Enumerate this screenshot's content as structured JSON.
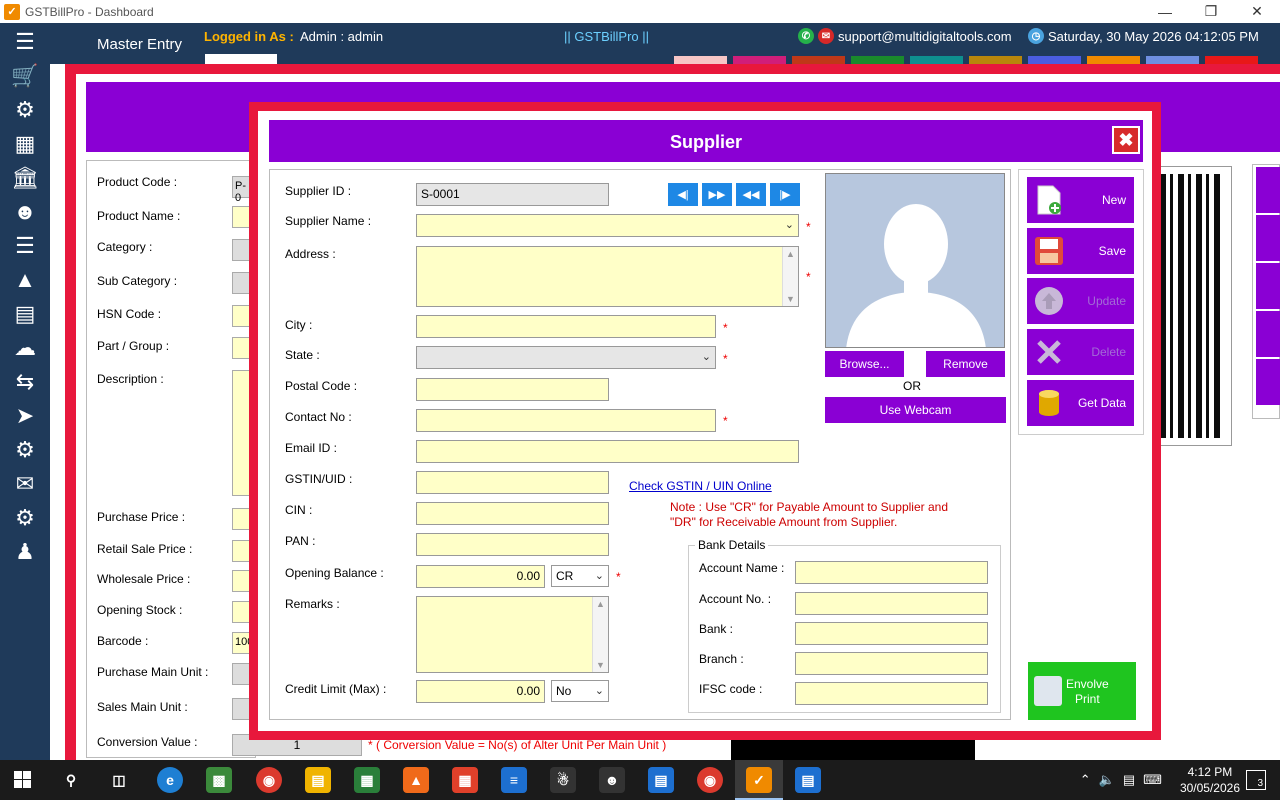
{
  "window": {
    "title": "GSTBillPro - Dashboard"
  },
  "header": {
    "section": "Master Entry",
    "logged_label": "Logged in As :",
    "user": "Admin   :  admin",
    "app_name": "|| GSTBillPro ||",
    "support_email": "support@multidigitaltools.com",
    "datetime": "Saturday, 30 May 2026 04:12:05 PM"
  },
  "colors": {
    "accent": "#8a00d4",
    "frame": "#e8183c",
    "field_bg": "#ffffc8",
    "header_bg": "#1f3a5a",
    "print_green": "#1fc51f"
  },
  "product_form": {
    "labels": [
      "Product Code :",
      "Product Name :",
      "Category :",
      "Sub Category :",
      "HSN Code :",
      "Part / Group :",
      "Description :",
      "Purchase Price :",
      "Retail Sale Price :",
      "Wholesale Price :",
      "Opening Stock :",
      "Barcode :",
      "Purchase Main Unit :",
      "Sales Main Unit :",
      "Conversion Value :"
    ],
    "product_code_partial": "P-0",
    "barcode_partial": "100",
    "conversion_value": "1",
    "conversion_note": "* ( Corversion Value = No(s) of Alter Unit Per Main Unit )"
  },
  "dialog": {
    "title": "Supplier",
    "close_label": "✖",
    "supplier_id_label": "Supplier ID :",
    "supplier_id_value": "S-0001",
    "supplier_name_label": "Supplier Name :",
    "address_label": "Address :",
    "city_label": "City :",
    "state_label": "State :",
    "postal_label": "Postal Code :",
    "contact_label": "Contact No :",
    "email_label": "Email ID :",
    "gstin_label": "GSTIN/UID :",
    "cin_label": "CIN :",
    "pan_label": "PAN :",
    "opening_label": "Opening Balance :",
    "opening_value": "0.00",
    "opening_type": "CR",
    "remarks_label": "Remarks :",
    "credit_label": "Credit Limit (Max) :",
    "credit_value": "0.00",
    "credit_type": "No",
    "required_mark": "*",
    "check_gstin_link": "Check GSTIN / UIN Online",
    "note": "Note : Use \"CR\" for Payable Amount to Supplier and \"DR\" for Receivable Amount from Supplier.",
    "browse_label": "Browse...",
    "remove_label": "Remove",
    "or_label": "OR",
    "webcam_label": "Use Webcam",
    "bank": {
      "legend": "Bank Details",
      "account_name": "Account Name :",
      "account_no": "Account No. :",
      "bank": "Bank :",
      "branch": "Branch :",
      "ifsc": "IFSC code :"
    },
    "actions": {
      "new": "New",
      "save": "Save",
      "update": "Update",
      "delete": "Delete",
      "get_data": "Get Data"
    },
    "print_label_1": "Envolve",
    "print_label_2": "Print",
    "nav_icons": [
      "first-record-icon",
      "next-record-icon",
      "previous-record-icon",
      "last-record-icon"
    ]
  },
  "taskbar": {
    "time": "4:12 PM",
    "date": "30/05/2026",
    "notifications": "3"
  }
}
